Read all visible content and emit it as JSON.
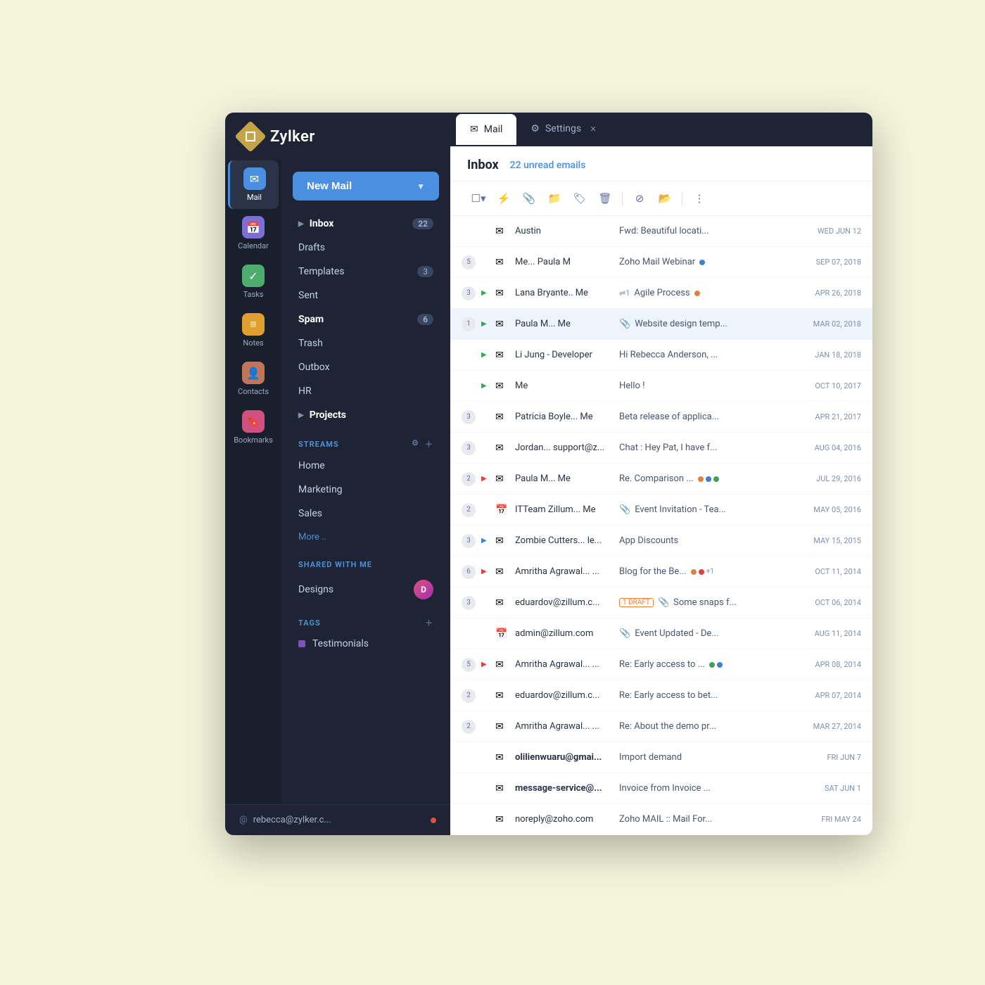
{
  "app": {
    "title": "Zylker",
    "user_email": "rebecca@zylker.c..."
  },
  "tabs": [
    {
      "id": "mail",
      "label": "Mail",
      "icon": "✉",
      "active": true
    },
    {
      "id": "settings",
      "label": "Settings",
      "icon": "⚙",
      "active": false
    }
  ],
  "sidebar": {
    "nav_items": [
      {
        "id": "mail",
        "label": "Mail",
        "icon_class": "icon-mail",
        "icon": "✉",
        "active": true
      },
      {
        "id": "calendar",
        "label": "Calendar",
        "icon_class": "icon-calendar",
        "icon": "📅",
        "active": false
      },
      {
        "id": "tasks",
        "label": "Tasks",
        "icon_class": "icon-tasks",
        "icon": "✓",
        "active": false
      },
      {
        "id": "notes",
        "label": "Notes",
        "icon_class": "icon-notes",
        "icon": "≡",
        "active": false
      },
      {
        "id": "contacts",
        "label": "Contacts",
        "icon_class": "icon-contacts",
        "icon": "👤",
        "active": false
      },
      {
        "id": "bookmarks",
        "label": "Bookmarks",
        "icon_class": "icon-bookmarks",
        "icon": "🔖",
        "active": false
      }
    ],
    "new_mail_label": "New Mail",
    "mail_folders": [
      {
        "id": "inbox",
        "label": "Inbox",
        "count": "22",
        "bold": true,
        "has_chevron": true
      },
      {
        "id": "drafts",
        "label": "Drafts",
        "count": "",
        "bold": false
      },
      {
        "id": "templates",
        "label": "Templates",
        "count": "3",
        "bold": false
      },
      {
        "id": "sent",
        "label": "Sent",
        "count": "",
        "bold": false
      },
      {
        "id": "spam",
        "label": "Spam",
        "count": "6",
        "bold": true
      },
      {
        "id": "trash",
        "label": "Trash",
        "count": "",
        "bold": false
      },
      {
        "id": "outbox",
        "label": "Outbox",
        "count": "",
        "bold": false
      },
      {
        "id": "hr",
        "label": "HR",
        "count": "",
        "bold": false
      },
      {
        "id": "projects",
        "label": "Projects",
        "count": "",
        "bold": true,
        "has_chevron": true
      }
    ],
    "streams_label": "STREAMS",
    "streams": [
      {
        "id": "home",
        "label": "Home"
      },
      {
        "id": "marketing",
        "label": "Marketing"
      },
      {
        "id": "sales",
        "label": "Sales"
      }
    ],
    "more_label": "More ..",
    "shared_label": "SHARED WITH ME",
    "shared_items": [
      {
        "id": "designs",
        "label": "Designs",
        "avatar_text": "D"
      }
    ],
    "tags_label": "TAGS",
    "tags": [
      {
        "id": "testimonials",
        "label": "Testimonials",
        "color": "#8050c0"
      }
    ]
  },
  "inbox": {
    "title": "Inbox",
    "unread_label": "22 unread emails",
    "emails": [
      {
        "id": 1,
        "count": "",
        "flag": "",
        "avatar": "✉",
        "sender": "Austin",
        "preview": "Fwd: Beautiful locati...",
        "attachment": false,
        "thread": false,
        "draft": "",
        "date": "WED JUN 12",
        "color_dots": [],
        "selected": false,
        "unread": false
      },
      {
        "id": 2,
        "count": "5",
        "flag": "",
        "avatar": "✉",
        "sender": "Me... Paula M",
        "preview": "Zoho Mail Webinar",
        "attachment": false,
        "thread": false,
        "draft": "",
        "date": "SEP 07, 2018",
        "color_dots": [
          "blue"
        ],
        "selected": false,
        "unread": false
      },
      {
        "id": 3,
        "count": "3",
        "flag": "green",
        "avatar": "✉",
        "sender": "Lana Bryante.. Me",
        "preview": "Agile Process",
        "attachment": false,
        "thread": true,
        "draft": "",
        "date": "APR 26, 2018",
        "color_dots": [
          "orange"
        ],
        "selected": false,
        "unread": false
      },
      {
        "id": 4,
        "count": "1",
        "flag": "green",
        "avatar": "✉",
        "sender": "Paula M... Me",
        "preview": "Website design temp...",
        "attachment": true,
        "thread": false,
        "draft": "",
        "date": "MAR 02, 2018",
        "color_dots": [],
        "selected": true,
        "unread": false
      },
      {
        "id": 5,
        "count": "",
        "flag": "green",
        "avatar": "✉",
        "sender": "Li Jung - Developer",
        "preview": "Hi Rebecca Anderson, ...",
        "attachment": false,
        "thread": false,
        "draft": "",
        "date": "JAN 18, 2018",
        "color_dots": [],
        "selected": false,
        "unread": false
      },
      {
        "id": 6,
        "count": "",
        "flag": "green",
        "avatar": "✉",
        "sender": "Me",
        "preview": "Hello !",
        "attachment": false,
        "thread": false,
        "draft": "",
        "date": "OCT 10, 2017",
        "color_dots": [],
        "selected": false,
        "unread": false
      },
      {
        "id": 7,
        "count": "3",
        "flag": "",
        "avatar": "↺",
        "sender": "Patricia Boyle... Me",
        "preview": "Beta release of applica...",
        "attachment": false,
        "thread": false,
        "draft": "",
        "date": "APR 21, 2017",
        "color_dots": [],
        "selected": false,
        "unread": false
      },
      {
        "id": 8,
        "count": "3",
        "flag": "",
        "avatar": "✉",
        "sender": "Jordan... support@z...",
        "preview": "Chat : Hey Pat, I have f...",
        "attachment": false,
        "thread": false,
        "draft": "",
        "date": "AUG 04, 2016",
        "color_dots": [],
        "selected": false,
        "unread": false
      },
      {
        "id": 9,
        "count": "2",
        "flag": "red",
        "avatar": "✉",
        "sender": "Paula M... Me",
        "preview": "Re. Comparison ...",
        "attachment": false,
        "thread": false,
        "draft": "",
        "date": "JUL 29, 2016",
        "color_dots": [
          "orange",
          "blue",
          "green"
        ],
        "selected": false,
        "unread": false
      },
      {
        "id": 10,
        "count": "2",
        "flag": "",
        "avatar": "📅",
        "sender": "ITTeam Zillum... Me",
        "preview": "Event Invitation - Tea...",
        "attachment": true,
        "thread": false,
        "draft": "",
        "date": "MAY 05, 2016",
        "color_dots": [],
        "selected": false,
        "unread": false
      },
      {
        "id": 11,
        "count": "3",
        "flag": "blue",
        "avatar": "✉",
        "sender": "Zombie Cutters... le...",
        "preview": "App Discounts",
        "attachment": false,
        "thread": false,
        "draft": "",
        "date": "MAY 15, 2015",
        "color_dots": [],
        "selected": false,
        "unread": false
      },
      {
        "id": 12,
        "count": "6",
        "flag": "red",
        "avatar": "✉",
        "sender": "Amritha Agrawal... ...",
        "preview": "Blog for the Be...",
        "attachment": false,
        "thread": false,
        "draft": "",
        "date": "OCT 11, 2014",
        "color_dots": [
          "orange",
          "red"
        ],
        "plus_count": "+1",
        "selected": false,
        "unread": false
      },
      {
        "id": 13,
        "count": "3",
        "flag": "",
        "avatar": "✉",
        "sender": "eduardov@zillum.c...",
        "preview": "Some snaps f...",
        "attachment": true,
        "thread": false,
        "draft": "1 DRAFT",
        "date": "OCT 06, 2014",
        "color_dots": [],
        "selected": false,
        "unread": false
      },
      {
        "id": 14,
        "count": "",
        "flag": "",
        "avatar": "📅",
        "sender": "admin@zillum.com",
        "preview": "Event Updated - De...",
        "attachment": true,
        "thread": false,
        "draft": "",
        "date": "AUG 11, 2014",
        "color_dots": [],
        "selected": false,
        "unread": false
      },
      {
        "id": 15,
        "count": "5",
        "flag": "red",
        "avatar": "✉",
        "sender": "Amritha Agrawal... ...",
        "preview": "Re: Early access to ...",
        "attachment": false,
        "thread": false,
        "draft": "",
        "date": "APR 08, 2014",
        "color_dots": [
          "green",
          "blue"
        ],
        "selected": false,
        "unread": false
      },
      {
        "id": 16,
        "count": "2",
        "flag": "",
        "avatar": "✉",
        "sender": "eduardov@zillum.c...",
        "preview": "Re: Early access to bet...",
        "attachment": false,
        "thread": false,
        "draft": "",
        "date": "APR 07, 2014",
        "color_dots": [],
        "selected": false,
        "unread": false
      },
      {
        "id": 17,
        "count": "2",
        "flag": "",
        "avatar": "✉",
        "sender": "Amritha Agrawal... ...",
        "preview": "Re: About the demo pr...",
        "attachment": false,
        "thread": false,
        "draft": "",
        "date": "MAR 27, 2014",
        "color_dots": [],
        "selected": false,
        "unread": false
      },
      {
        "id": 18,
        "count": "",
        "flag": "",
        "avatar": "✉",
        "sender": "olilienwuaru@gmai...",
        "preview": "Import demand",
        "attachment": false,
        "thread": false,
        "draft": "",
        "date": "FRI JUN 7",
        "color_dots": [],
        "selected": false,
        "unread": true
      },
      {
        "id": 19,
        "count": "",
        "flag": "",
        "avatar": "✉",
        "sender": "message-service@...",
        "preview": "Invoice from Invoice ...",
        "attachment": false,
        "thread": false,
        "draft": "",
        "date": "SAT JUN 1",
        "color_dots": [],
        "selected": false,
        "unread": true
      },
      {
        "id": 20,
        "count": "",
        "flag": "",
        "avatar": "✉",
        "sender": "noreply@zoho.com",
        "preview": "Zoho MAIL :: Mail For...",
        "attachment": false,
        "thread": false,
        "draft": "",
        "date": "FRI MAY 24",
        "color_dots": [],
        "selected": false,
        "unread": false
      }
    ]
  }
}
